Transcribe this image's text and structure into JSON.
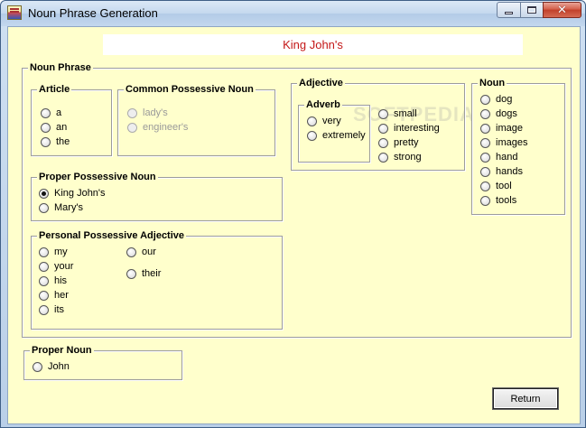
{
  "window": {
    "title": "Noun Phrase Generation"
  },
  "display_text": "King John's",
  "watermark": "SOFTPEDIA",
  "noun_phrase": {
    "label": "Noun Phrase",
    "article": {
      "label": "Article",
      "options": [
        "a",
        "an",
        "the"
      ]
    },
    "common_possessive": {
      "label": "Common Possessive Noun",
      "options": [
        "lady's",
        "engineer's"
      ],
      "disabled": true
    },
    "proper_possessive": {
      "label": "Proper Possessive Noun",
      "options": [
        "King John's",
        "Mary's"
      ],
      "selected": "King John's"
    },
    "personal_possessive": {
      "label": "Personal Possessive Adjective",
      "col1": [
        "my",
        "your",
        "his",
        "her",
        "its"
      ],
      "col2": [
        "our",
        "their"
      ]
    },
    "adjective": {
      "label": "Adjective",
      "adverb": {
        "label": "Adverb",
        "options": [
          "very",
          "extremely"
        ]
      },
      "options": [
        "small",
        "interesting",
        "pretty",
        "strong"
      ]
    },
    "noun": {
      "label": "Noun",
      "options": [
        "dog",
        "dogs",
        "image",
        "images",
        "hand",
        "hands",
        "tool",
        "tools"
      ]
    }
  },
  "proper_noun": {
    "label": "Proper Noun",
    "options": [
      "John"
    ]
  },
  "buttons": {
    "return_label": "Return"
  }
}
